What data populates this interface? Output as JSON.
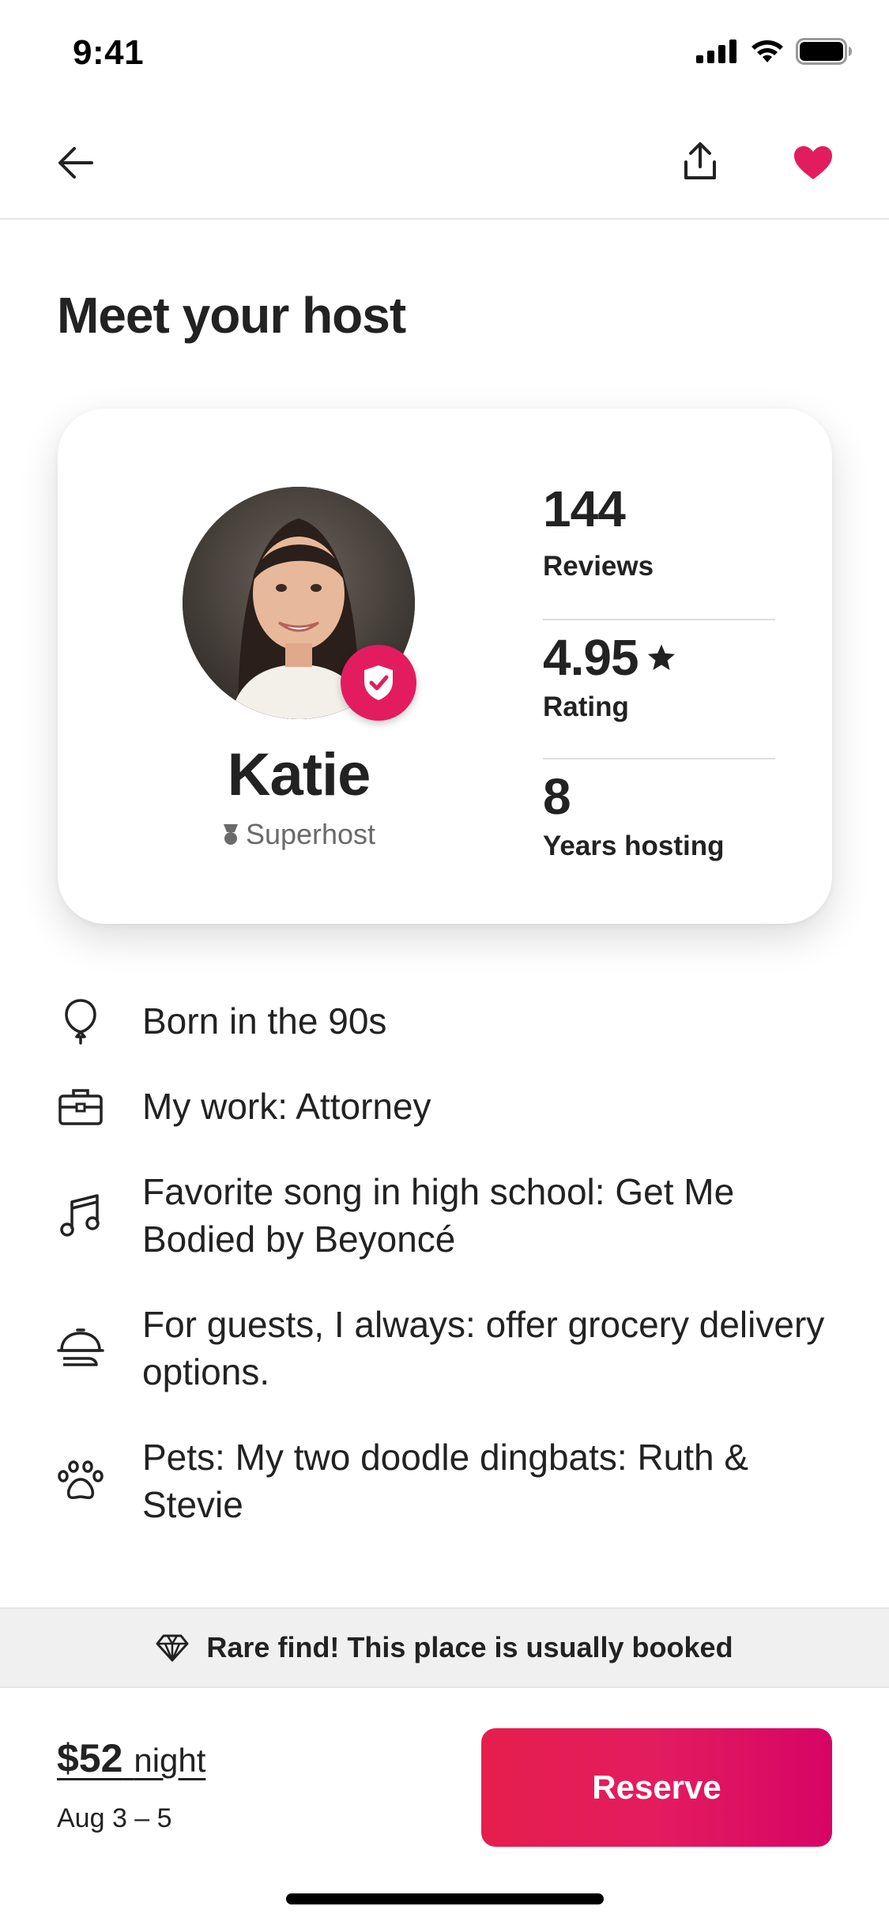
{
  "status_bar": {
    "time": "9:41"
  },
  "page": {
    "title": "Meet your host"
  },
  "host": {
    "name": "Katie",
    "badge": "Superhost",
    "stats": [
      {
        "value": "144",
        "label": "Reviews"
      },
      {
        "value": "4.95",
        "label": "Rating"
      },
      {
        "value": "8",
        "label": "Years hosting"
      }
    ]
  },
  "facts": [
    {
      "icon": "balloon-icon",
      "text": "Born in the 90s"
    },
    {
      "icon": "briefcase-icon",
      "text": "My work: Attorney"
    },
    {
      "icon": "music-note-icon",
      "text": "Favorite song in high school: Get Me Bodied by Beyoncé"
    },
    {
      "icon": "serving-dish-icon",
      "text": "For guests, I always: offer grocery delivery options."
    },
    {
      "icon": "paw-icon",
      "text": "Pets: My two doodle dingbats: Ruth & Stevie"
    }
  ],
  "rare_find": {
    "text": "Rare find! This place is usually booked"
  },
  "footer": {
    "price": "$52",
    "price_unit": "night",
    "dates": "Aug 3 – 5",
    "reserve_label": "Reserve"
  },
  "colors": {
    "brand": "#e31c5f",
    "text": "#222222",
    "muted": "#6a6a6a"
  }
}
